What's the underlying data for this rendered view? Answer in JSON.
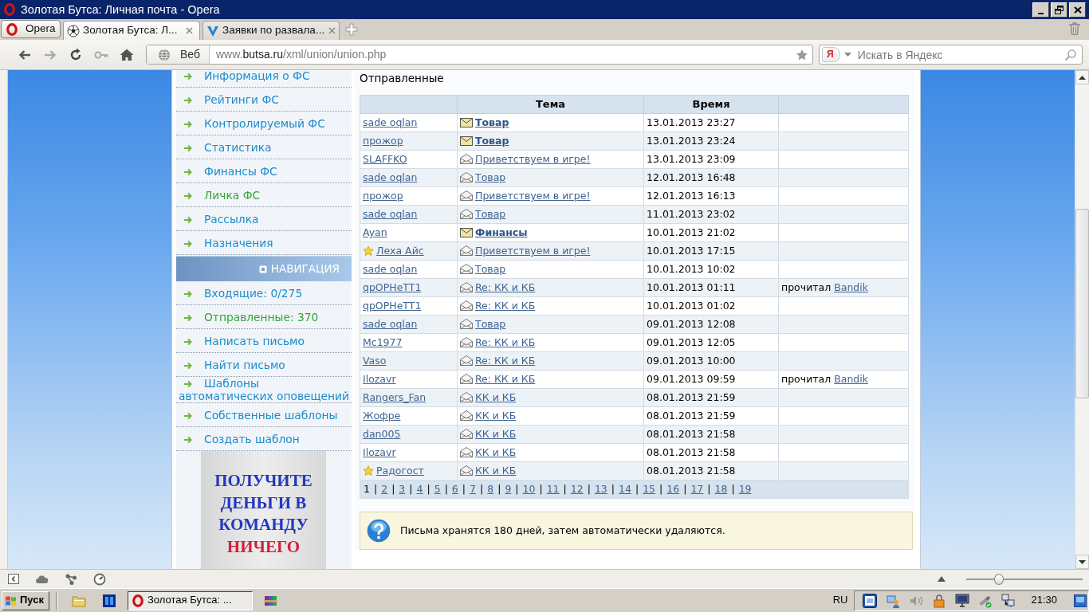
{
  "window": {
    "title": "Золотая Бутса: Личная почта - Opera"
  },
  "browser": {
    "menu_button": "Opera",
    "tabs": [
      {
        "label": "Золотая Бутса: Л...",
        "selected": true
      },
      {
        "label": "Заявки по развала...",
        "selected": false
      }
    ],
    "address_bar": {
      "scope": "Веб",
      "url_parts": [
        {
          "text": "www.",
          "emphasis": false
        },
        {
          "text": "butsa.ru",
          "emphasis": true
        },
        {
          "text": "/xml/union/union.php",
          "emphasis": false
        }
      ]
    },
    "search": {
      "engine_logo": "Я",
      "placeholder": "Искать в Яндекс"
    }
  },
  "sidebar": {
    "menu": [
      {
        "label": "Информация о ФС",
        "selected": false
      },
      {
        "label": "Рейтинги ФС",
        "selected": false
      },
      {
        "label": "Контролируемый ФС",
        "selected": false
      },
      {
        "label": "Статистика",
        "selected": false
      },
      {
        "label": "Финансы ФС",
        "selected": false
      },
      {
        "label": "Личка ФС",
        "selected": true
      },
      {
        "label": "Рассылка",
        "selected": false
      },
      {
        "label": "Назначения",
        "selected": false
      }
    ],
    "navigation": {
      "title": "НАВИГАЦИЯ",
      "items": [
        {
          "label": "Входящие: 0/275",
          "selected": false
        },
        {
          "label": "Отправленные: 370",
          "selected": true
        },
        {
          "label": "Написать письмо",
          "selected": false
        },
        {
          "label": "Найти письмо",
          "selected": false
        },
        {
          "label": "Шаблоны автоматических оповещений",
          "selected": false
        },
        {
          "label": "Собственные шаблоны",
          "selected": false
        },
        {
          "label": "Создать шаблон",
          "selected": false
        }
      ]
    },
    "banner": {
      "lines": [
        {
          "text": "ПОЛУЧИТЕ ДЕНЬГИ В КОМАНДУ",
          "color": "#2337c2"
        },
        {
          "text": "НИЧЕГО",
          "color": "#d61f3d"
        }
      ]
    }
  },
  "main": {
    "heading": "Отправленные",
    "table": {
      "header": {
        "column_2": "Тема",
        "column_3": "Время"
      },
      "rows": [
        {
          "column_1": "sade oqlan",
          "starred": false,
          "subject": "Товар",
          "unread": true,
          "time": "13.01.2013 23:27"
        },
        {
          "column_1": "прожор",
          "starred": false,
          "subject": "Товар",
          "unread": true,
          "time": "13.01.2013 23:24"
        },
        {
          "column_1": "SLAFFKO",
          "starred": false,
          "subject": "Приветствуем в игре!",
          "unread": false,
          "time": "13.01.2013 23:09"
        },
        {
          "column_1": "sade oqlan",
          "starred": false,
          "subject": "Товар",
          "unread": false,
          "time": "12.01.2013 16:48"
        },
        {
          "column_1": "прожор",
          "starred": false,
          "subject": "Приветствуем в игре!",
          "unread": false,
          "time": "12.01.2013 16:13"
        },
        {
          "column_1": "sade oqlan",
          "starred": false,
          "subject": "Товар",
          "unread": false,
          "time": "11.01.2013 23:02"
        },
        {
          "column_1": "Ayan",
          "starred": false,
          "subject": "Финансы",
          "unread": true,
          "time": "10.01.2013 21:02"
        },
        {
          "column_1": "Леха Айс",
          "starred": true,
          "subject": "Приветствуем в игре!",
          "unread": false,
          "time": "10.01.2013 17:15"
        },
        {
          "column_1": "sade oqlan",
          "starred": false,
          "subject": "Товар",
          "unread": false,
          "time": "10.01.2013 10:02"
        },
        {
          "column_1": "qpOPHeTT1",
          "starred": false,
          "subject": "Re: КК и КБ",
          "unread": false,
          "time": "10.01.2013 01:11",
          "column_4": {
            "text": "прочитал",
            "link": "Bandik"
          }
        },
        {
          "column_1": "qpOPHeTT1",
          "starred": false,
          "subject": "Re: КК и КБ",
          "unread": false,
          "time": "10.01.2013 01:02"
        },
        {
          "column_1": "sade oqlan",
          "starred": false,
          "subject": "Товар",
          "unread": false,
          "time": "09.01.2013 12:08"
        },
        {
          "column_1": "Mc1977",
          "starred": false,
          "subject": "Re: КК и КБ",
          "unread": false,
          "time": "09.01.2013 12:05"
        },
        {
          "column_1": "Vaso",
          "starred": false,
          "subject": "Re: КК и КБ",
          "unread": false,
          "time": "09.01.2013 10:00"
        },
        {
          "column_1": "Ilozavr",
          "starred": false,
          "subject": "Re: КК и КБ",
          "unread": false,
          "time": "09.01.2013 09:59",
          "column_4": {
            "text": "прочитал",
            "link": "Bandik"
          }
        },
        {
          "column_1": "Rangers_Fan",
          "starred": false,
          "subject": "КК и КБ",
          "unread": false,
          "time": "08.01.2013 21:59"
        },
        {
          "column_1": "Жофре",
          "starred": false,
          "subject": "КК и КБ",
          "unread": false,
          "time": "08.01.2013 21:59"
        },
        {
          "column_1": "dan005",
          "starred": false,
          "subject": "КК и КБ",
          "unread": false,
          "time": "08.01.2013 21:58"
        },
        {
          "column_1": "Ilozavr",
          "starred": false,
          "subject": "КК и КБ",
          "unread": false,
          "time": "08.01.2013 21:58"
        },
        {
          "column_1": "Радогост",
          "starred": true,
          "subject": "КК и КБ",
          "unread": false,
          "time": "08.01.2013 21:58"
        }
      ]
    },
    "pagination": {
      "separator": "|",
      "pages": [
        {
          "label": "1",
          "selected": true
        },
        {
          "label": "2",
          "selected": false
        },
        {
          "label": "3",
          "selected": false
        },
        {
          "label": "4",
          "selected": false
        },
        {
          "label": "5",
          "selected": false
        },
        {
          "label": "6",
          "selected": false
        },
        {
          "label": "7",
          "selected": false
        },
        {
          "label": "8",
          "selected": false
        },
        {
          "label": "9",
          "selected": false
        },
        {
          "label": "10",
          "selected": false
        },
        {
          "label": "11",
          "selected": false
        },
        {
          "label": "12",
          "selected": false
        },
        {
          "label": "13",
          "selected": false
        },
        {
          "label": "14",
          "selected": false
        },
        {
          "label": "15",
          "selected": false
        },
        {
          "label": "16",
          "selected": false
        },
        {
          "label": "17",
          "selected": false
        },
        {
          "label": "18",
          "selected": false
        },
        {
          "label": "19",
          "selected": false
        }
      ]
    },
    "notice": "Письма хранятся 180 дней, затем автоматически удаляются."
  },
  "status_bar": {
    "zoom_slider": {
      "level": 0.28
    }
  },
  "taskbar": {
    "start_button": "Пуск",
    "tasks": [
      {
        "label": "Золотая Бутса: ...",
        "selected": true
      }
    ],
    "language": "RU",
    "clock": "21:30"
  }
}
